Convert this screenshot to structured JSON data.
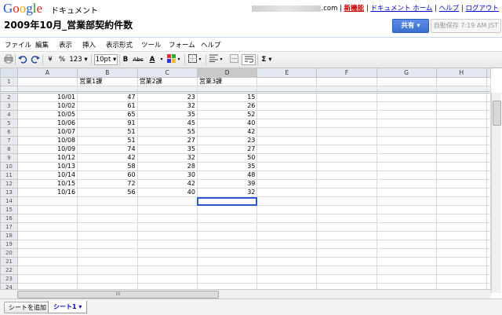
{
  "header": {
    "logo": "Google",
    "product": "ドキュメント",
    "email_suffix": ".com",
    "links": [
      "新機能",
      "ドキュメント ホーム",
      "ヘルプ",
      "ログアウト"
    ],
    "doc_title": "2009年10月_営業部契約件数",
    "share_label": "共有 ▾",
    "autosave": "自動保存 7:19 AM JST"
  },
  "menu": [
    "ファイル",
    "編集",
    "表示",
    "挿入",
    "表示形式",
    "ツール",
    "フォーム",
    "ヘルプ"
  ],
  "toolbar": {
    "currency": "¥",
    "percent": "%",
    "number_format": "123 ▾",
    "font_size": "10pt ▾",
    "bold": "B",
    "strike": "Abc",
    "text_color": "A",
    "sum": "Σ ▾"
  },
  "columns": [
    "A",
    "B",
    "C",
    "D",
    "E",
    "F",
    "G",
    "H"
  ],
  "selected_column": "D",
  "header_row": [
    "",
    "営業1課",
    "営業2課",
    "営業3課",
    "",
    "",
    "",
    ""
  ],
  "rows": [
    [
      "10/01",
      "47",
      "23",
      "15"
    ],
    [
      "10/02",
      "61",
      "32",
      "26"
    ],
    [
      "10/05",
      "65",
      "35",
      "52"
    ],
    [
      "10/06",
      "91",
      "45",
      "40"
    ],
    [
      "10/07",
      "51",
      "55",
      "42"
    ],
    [
      "10/08",
      "51",
      "27",
      "23"
    ],
    [
      "10/09",
      "74",
      "35",
      "27"
    ],
    [
      "10/12",
      "42",
      "32",
      "50"
    ],
    [
      "10/13",
      "58",
      "28",
      "35"
    ],
    [
      "10/14",
      "60",
      "30",
      "48"
    ],
    [
      "10/15",
      "72",
      "42",
      "39"
    ],
    [
      "10/16",
      "56",
      "40",
      "32"
    ]
  ],
  "active_cell": "D14",
  "total_rows": 24,
  "scroll_thumb_label": "III",
  "sheets": {
    "add_label": "シートを追加",
    "tabs": [
      "シート1 ▾"
    ]
  }
}
